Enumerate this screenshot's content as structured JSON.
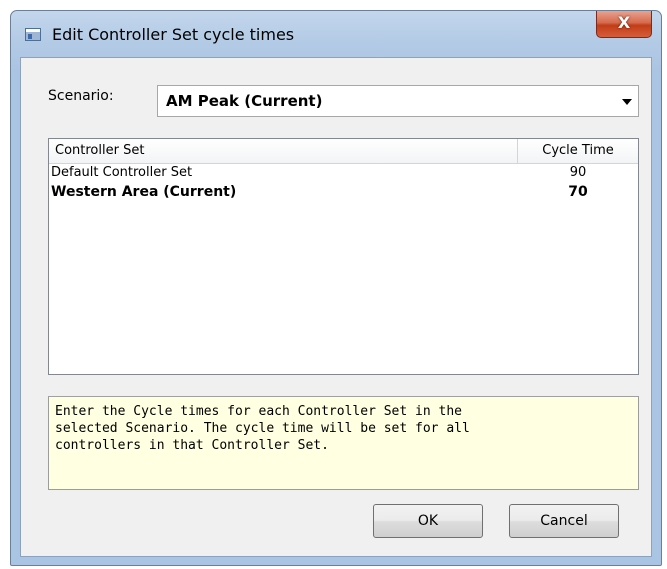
{
  "window": {
    "title": "Edit Controller Set cycle times",
    "close_label": "X"
  },
  "scenario": {
    "label": "Scenario:",
    "selected": "AM Peak (Current)"
  },
  "table": {
    "columns": [
      "Controller Set",
      "Cycle Time"
    ],
    "rows": [
      {
        "name": "Default Controller Set",
        "cycle_time": "90",
        "bold": false
      },
      {
        "name": "Western Area (Current)",
        "cycle_time": "70",
        "bold": true
      }
    ]
  },
  "hint": {
    "lines": [
      "Enter the Cycle times for each Controller Set in the",
      "selected Scenario. The cycle time will be set for all",
      "controllers in that Controller Set."
    ]
  },
  "buttons": {
    "ok_label": "OK",
    "cancel_label": "Cancel"
  }
}
